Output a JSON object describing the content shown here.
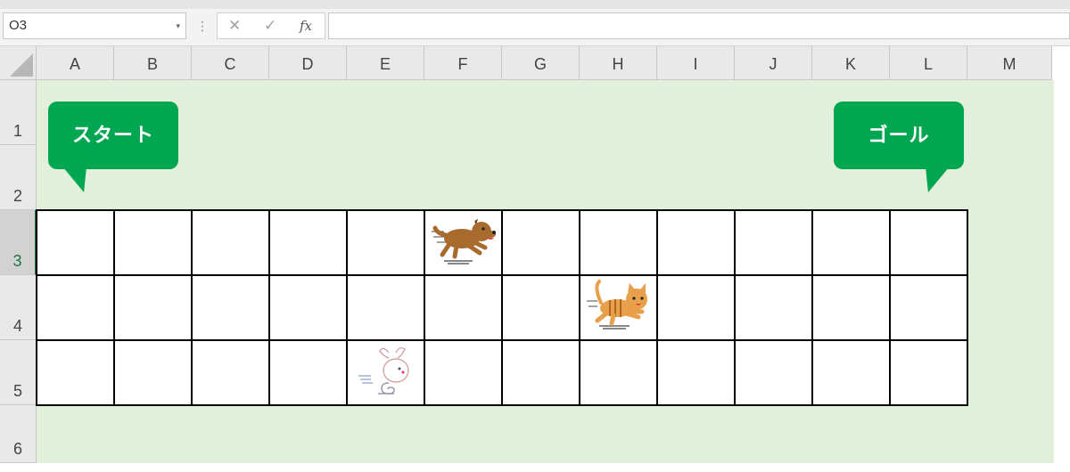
{
  "formula_bar": {
    "name_box": "O3",
    "name_box_caret": "▾",
    "separator": "⋮",
    "cancel_icon": "✕",
    "enter_icon": "✓",
    "function_icon": "fx",
    "formula": ""
  },
  "columns": [
    "A",
    "B",
    "C",
    "D",
    "E",
    "F",
    "G",
    "H",
    "I",
    "J",
    "K",
    "L",
    "M"
  ],
  "rows": [
    "1",
    "2",
    "3",
    "4",
    "5",
    "6"
  ],
  "active_row": "3",
  "labels": {
    "start": "スタート",
    "goal": "ゴール"
  },
  "animals": [
    {
      "name": "dog",
      "row": 3,
      "col": "F"
    },
    {
      "name": "cat",
      "row": 4,
      "col": "H"
    },
    {
      "name": "rabbit",
      "row": 5,
      "col": "E"
    }
  ],
  "colors": {
    "sheet_background": "#e2efda",
    "bubble": "#00a650",
    "active_header": "#217346"
  }
}
